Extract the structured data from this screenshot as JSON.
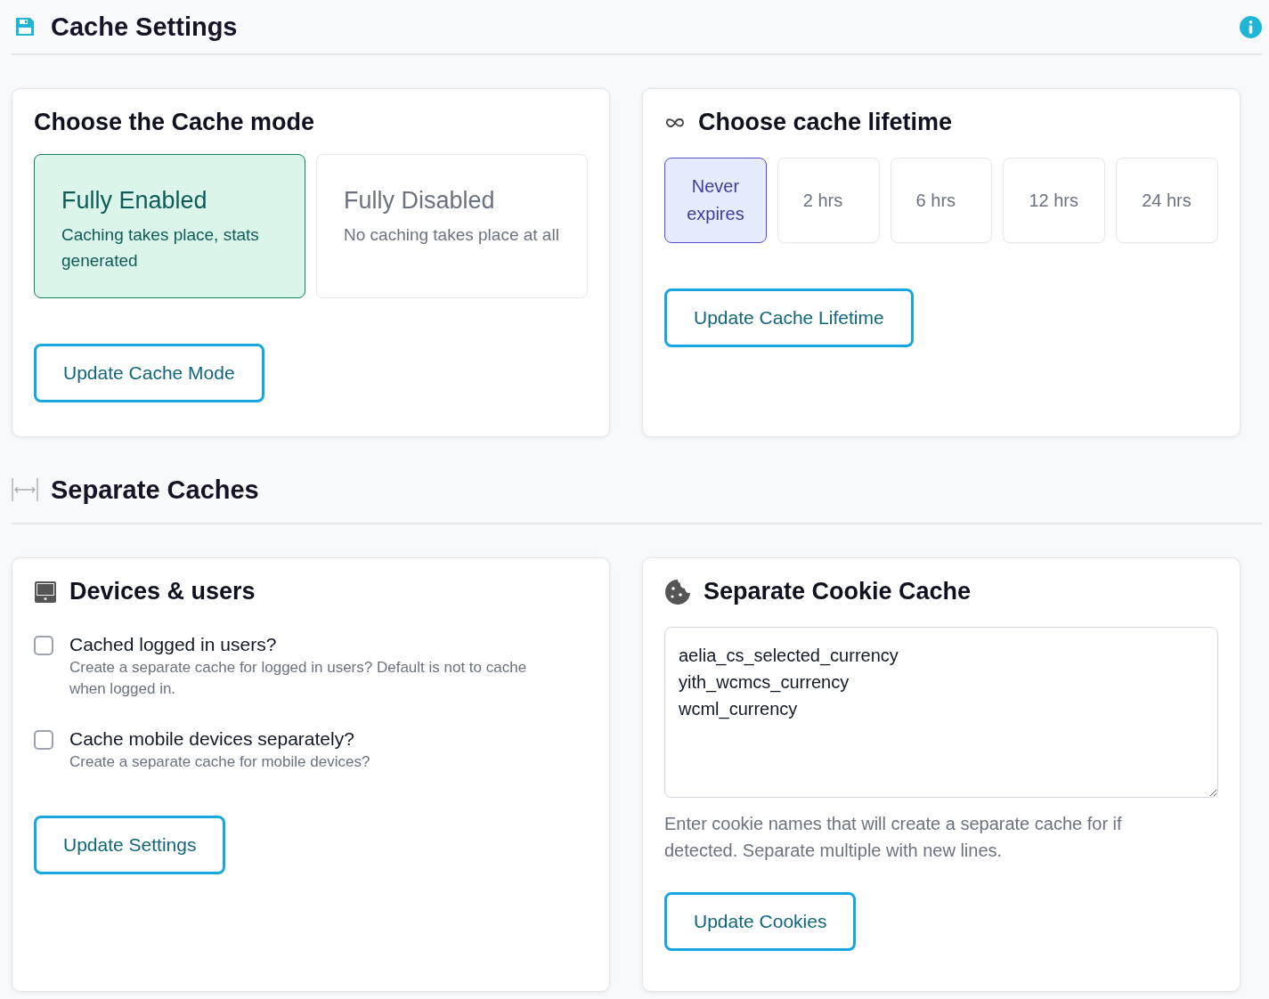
{
  "header": {
    "title": "Cache Settings"
  },
  "cache_mode": {
    "title": "Choose the Cache mode",
    "options": [
      {
        "title": "Fully Enabled",
        "description": "Caching takes place, stats generated",
        "selected": true
      },
      {
        "title": "Fully Disabled",
        "description": "No caching takes place at all",
        "selected": false
      }
    ],
    "button": "Update Cache Mode"
  },
  "lifetime": {
    "title": "Choose cache lifetime",
    "options": [
      {
        "label": "Never expires",
        "selected": true
      },
      {
        "label": "2 hrs",
        "selected": false
      },
      {
        "label": "6 hrs",
        "selected": false
      },
      {
        "label": "12 hrs",
        "selected": false
      },
      {
        "label": "24 hrs",
        "selected": false
      }
    ],
    "button": "Update Cache Lifetime"
  },
  "section": {
    "title": "Separate Caches"
  },
  "devices": {
    "title": "Devices & users",
    "options": [
      {
        "label": "Cached logged in users?",
        "description": "Create a separate cache for logged in users? Default is not to cache when logged in.",
        "checked": false
      },
      {
        "label": "Cache mobile devices separately?",
        "description": "Create a separate cache for mobile devices?",
        "checked": false
      }
    ],
    "button": "Update Settings"
  },
  "cookies": {
    "title": "Separate Cookie Cache",
    "value": "aelia_cs_selected_currency\nyith_wcmcs_currency\nwcml_currency",
    "help": "Enter cookie names that will create a separate cache for if detected. Separate multiple with new lines.",
    "button": "Update Cookies"
  }
}
